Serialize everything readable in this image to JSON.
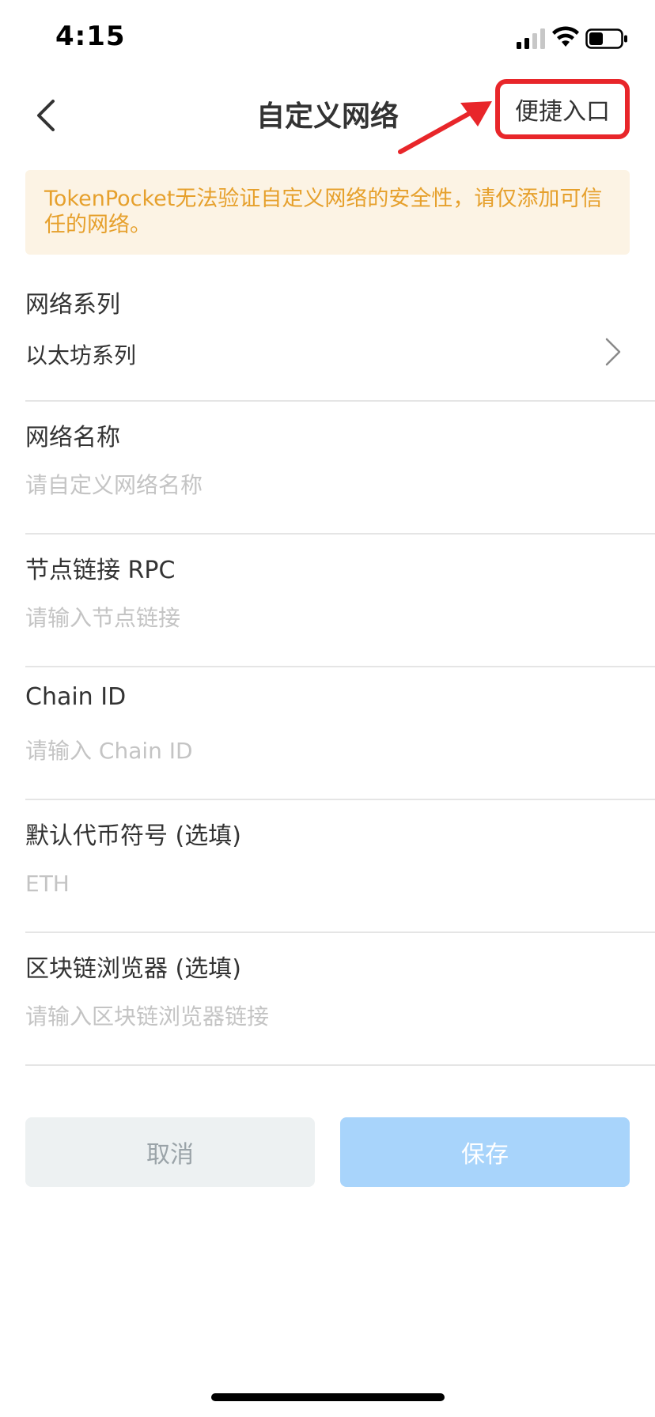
{
  "status_bar": {
    "time": "4:15",
    "icons": [
      "signal-icon",
      "wifi-icon",
      "battery-icon"
    ]
  },
  "nav": {
    "back_icon": "chevron-left-icon",
    "title": "自定义网络",
    "shortcut_label": "便捷入口"
  },
  "annotation": {
    "highlight_color": "#e8262a"
  },
  "warning": {
    "text": "TokenPocket无法验证自定义网络的安全性，请仅添加可信任的网络。",
    "color": "#e6a02c",
    "background": "#fcf3e4"
  },
  "form": {
    "network_series": {
      "label": "网络系列",
      "value": "以太坊系列"
    },
    "network_name": {
      "label": "网络名称",
      "placeholder": "请自定义网络名称"
    },
    "rpc_url": {
      "label": "节点链接 RPC",
      "placeholder": "请输入节点链接"
    },
    "chain_id": {
      "label": "Chain ID",
      "placeholder": "请输入 Chain ID"
    },
    "currency_symbol": {
      "label": "默认代币符号 (选填)",
      "placeholder": "ETH"
    },
    "explorer_url": {
      "label": "区块链浏览器 (选填)",
      "placeholder": "请输入区块链浏览器链接"
    }
  },
  "actions": {
    "cancel_label": "取消",
    "save_label": "保存",
    "save_color": "#a8d4fb"
  }
}
